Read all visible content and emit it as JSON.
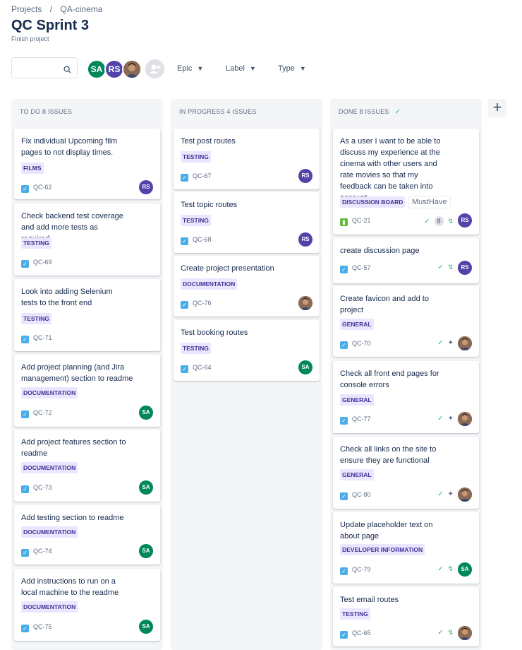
{
  "breadcrumb": {
    "projects": "Projects",
    "separator": "/",
    "project": "QA-cinema"
  },
  "title": "QC Sprint 3",
  "subtitle": "Finish project",
  "search": {
    "placeholder": ""
  },
  "avatars": [
    {
      "initials": "SA",
      "color": "#00875a"
    },
    {
      "initials": "RS",
      "color": "#5243aa"
    },
    {
      "initials": "",
      "kind": "photo"
    }
  ],
  "filters": {
    "epic": "Epic",
    "label": "Label",
    "type": "Type"
  },
  "columns": [
    {
      "header": "TO DO 8 ISSUES",
      "cards": [
        {
          "title": "Fix individual Upcoming film pages to not display times.",
          "label": "FILMS",
          "key": "QC-62",
          "assignee": "RS"
        },
        {
          "title": "Check backend test coverage and add more tests as required",
          "label": "TESTING",
          "key": "QC-69",
          "assignee": ""
        },
        {
          "title": "Look into adding Selenium tests to the front end",
          "label": "TESTING",
          "key": "QC-71",
          "assignee": ""
        },
        {
          "title": "Add project planning (and Jira management) section to readme",
          "label": "DOCUMENTATION",
          "key": "QC-72",
          "assignee": "SA"
        },
        {
          "title": "Add project features section to readme",
          "label": "DOCUMENTATION",
          "key": "QC-73",
          "assignee": "SA"
        },
        {
          "title": "Add testing section to readme",
          "label": "DOCUMENTATION",
          "key": "QC-74",
          "assignee": "SA"
        },
        {
          "title": "Add instructions to run on a local machine to the readme",
          "label": "DOCUMENTATION",
          "key": "QC-75",
          "assignee": "SA"
        }
      ]
    },
    {
      "header": "IN PROGRESS 4 ISSUES",
      "cards": [
        {
          "title": "Test post routes",
          "label": "TESTING",
          "key": "QC-67",
          "assignee": "RS"
        },
        {
          "title": "Test topic routes",
          "label": "TESTING",
          "key": "QC-68",
          "assignee": "RS"
        },
        {
          "title": "Create project presentation",
          "label": "DOCUMENTATION",
          "key": "QC-76",
          "assignee": "photo"
        },
        {
          "title": "Test booking routes",
          "label": "TESTING",
          "key": "QC-64",
          "assignee": "SA"
        }
      ]
    },
    {
      "header": "DONE 8 ISSUES",
      "cards": [
        {
          "title": "As a user I want to be able to discuss my experience at the cinema with other users and rate movies so that my feedback can be taken into account.",
          "label": "DISCUSSION BOARD",
          "label2": "MustHave",
          "key": "QC-21",
          "points": "8",
          "assignee": "RS"
        },
        {
          "title": "create discussion page",
          "key": "QC-57",
          "assignee": "RS"
        },
        {
          "title": "Create favicon and add to project",
          "label": "GENERAL",
          "key": "QC-70",
          "assignee": "photo"
        },
        {
          "title": "Check all front end pages for console errors",
          "label": "GENERAL",
          "key": "QC-77",
          "assignee": "photo"
        },
        {
          "title": "Check all links on the site to ensure they are functional",
          "label": "GENERAL",
          "key": "QC-80",
          "assignee": "photo"
        },
        {
          "title": "Update placeholder text on about page",
          "label": "DEVELOPER INFORMATION",
          "key": "QC-79",
          "assignee": "SA"
        },
        {
          "title": "Test email routes",
          "label": "TESTING",
          "key": "QC-65",
          "assignee": "photo"
        }
      ]
    }
  ],
  "add_column": "+"
}
